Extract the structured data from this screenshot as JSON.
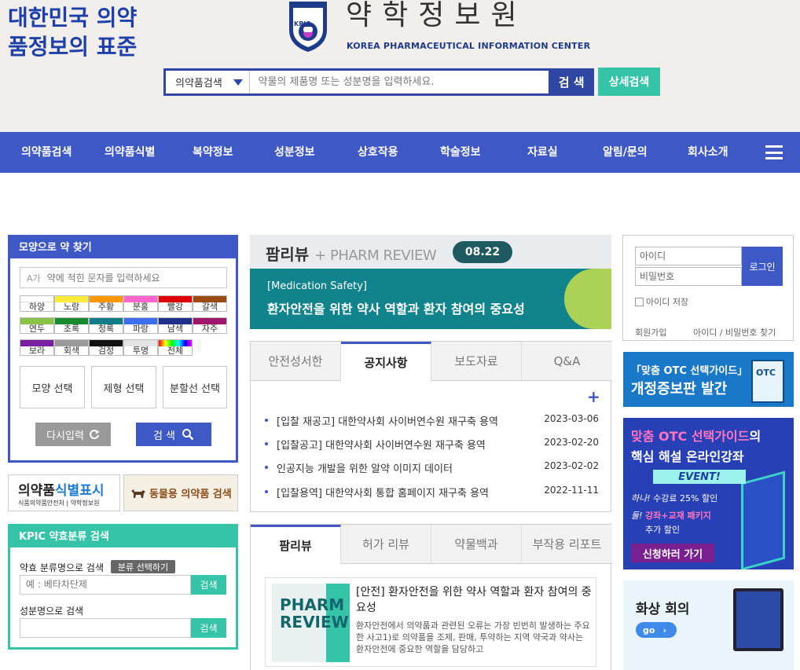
{
  "header": {
    "slogan": "대한민국 의약품정보의 표준",
    "logo_kr": "약학정보원",
    "logo_en": "KOREA PHARMACEUTICAL INFORMATION CENTER",
    "emblem_text": "KPIC",
    "search_type": "의약품검색",
    "search_placeholder": "약물의 제품명 또는 성분명을 입력하세요.",
    "search_button": "검 색",
    "detail_button": "상세검색"
  },
  "nav": {
    "items": [
      "의약품검색",
      "의약품식별",
      "복약정보",
      "성분정보",
      "상호작용",
      "학술정보",
      "자료실",
      "알림/문의",
      "회사소개"
    ]
  },
  "shape_search": {
    "title": "모양으로 약 찾기",
    "input_placeholder": "약에 적힌 문자를 입력하세요",
    "input_icon_label": "A가",
    "colors": [
      {
        "label": "하양",
        "hex": "#ffffff"
      },
      {
        "label": "노랑",
        "hex": "#ffeb3b"
      },
      {
        "label": "주황",
        "hex": "#ff9800"
      },
      {
        "label": "분홍",
        "hex": "#ff66cc"
      },
      {
        "label": "빨강",
        "hex": "#e00000"
      },
      {
        "label": "갈색",
        "hex": "#9c4b15"
      },
      {
        "label": "연두",
        "hex": "#8bc34a"
      },
      {
        "label": "초록",
        "hex": "#1a8a2e"
      },
      {
        "label": "청록",
        "hex": "#0f7c88"
      },
      {
        "label": "파랑",
        "hex": "#3e6ef0"
      },
      {
        "label": "남색",
        "hex": "#1f2f8c"
      },
      {
        "label": "자주",
        "hex": "#a0166d"
      },
      {
        "label": "보라",
        "hex": "#7a1fa2"
      },
      {
        "label": "회색",
        "hex": "#9a9a9a"
      },
      {
        "label": "검정",
        "hex": "#111111"
      },
      {
        "label": "투명",
        "hex": "#e4e4e4"
      },
      {
        "label": "전체",
        "hex": "rainbow"
      }
    ],
    "shape_button": "모양 선택",
    "form_button": "제형 선택",
    "split_button": "분할선 선택",
    "reset_button": "다시입력",
    "search_button": "검 색"
  },
  "banners_left": {
    "id_title_a": "의약품",
    "id_title_b": "식별표시",
    "id_sub": "식품의약품안전처 | 약학정보원",
    "animal": "동물용 의약품 검색"
  },
  "kpic_search": {
    "title": "KPIC 약효분류 검색",
    "class_label": "약효 분류명으로 검색",
    "class_select_button": "분류 선택하기",
    "class_placeholder": "예 : 베타차단제",
    "search_button": "검색",
    "ingredient_label": "성분명으로 검색",
    "ingredient_search_button": "검색"
  },
  "main_banner": {
    "brand_kr": "팜리뷰",
    "brand_en": "+ PHARM REVIEW",
    "date": "08.22",
    "sub": "[Medication Safety]",
    "title": "환자안전을 위한 약사 역할과 환자 참여의 중요성"
  },
  "notice_tabs": {
    "tabs": [
      "안전성서한",
      "공지사항",
      "보도자료",
      "Q&A"
    ],
    "plus": "+",
    "rows": [
      {
        "title": "[입찰 재공고] 대한약사회 사이버연수원 재구축 용역",
        "date": "2023-03-06"
      },
      {
        "title": "[입찰공고] 대한약사회 사이버연수원 재구축 용역",
        "date": "2023-02-20"
      },
      {
        "title": "인공지능 개발을 위한 알약 이미지 데이터",
        "date": "2023-02-02"
      },
      {
        "title": "[입찰용역] 대한약사회 통합 홈페이지 재구축 용역",
        "date": "2022-11-11"
      }
    ]
  },
  "review_tabs": {
    "tabs": [
      "팜리뷰",
      "허가 리뷰",
      "약물백과",
      "부작용 리포트"
    ],
    "thumb": "PHARM REVIEW",
    "card_title": "[안전] 환자안전을 위한 약사 역할과 환자 참여의 중요성",
    "card_body": "환자안전에서 의약품과 관련된 오류는 가장 빈번히 발생하는 주요한 사고1)로 의약품을 조제, 판매, 투약하는 지역 약국과 약사는 환자안전에 중요한 역할을 담당하고"
  },
  "login": {
    "id_placeholder": "아이디",
    "pw_placeholder": "비밀번호",
    "login_button": "로그인",
    "save_id": "아이디 저장",
    "join": "회원가입",
    "find": "아이디 / 비밀번호 찾기"
  },
  "banners_right": {
    "otc_l1": "「맞춤 OTC 선택가이드」",
    "otc_l2": "개정증보판 발간",
    "otc_book": "OTC",
    "lecture_l1a": "맞춤 OTC 선택가이드",
    "lecture_l1b": "의",
    "lecture_l2": "핵심 해설 온라인강좌",
    "lecture_event": "EVENT!",
    "lecture_l3a": "하나!",
    "lecture_l3b": "수강료 25% 할인",
    "lecture_l4a": "둘!",
    "lecture_l4b": "강좌+교재 패키지",
    "lecture_l5": "추가 할인",
    "lecture_apply": "신청하러 가기",
    "video_title": "화상 회의",
    "video_go": "go"
  },
  "colors": {
    "nav_blue": "#3e58c5",
    "teal": "#35c4a8",
    "header_bg": "#f1eeec",
    "slogan_blue": "#1e3fa9"
  }
}
